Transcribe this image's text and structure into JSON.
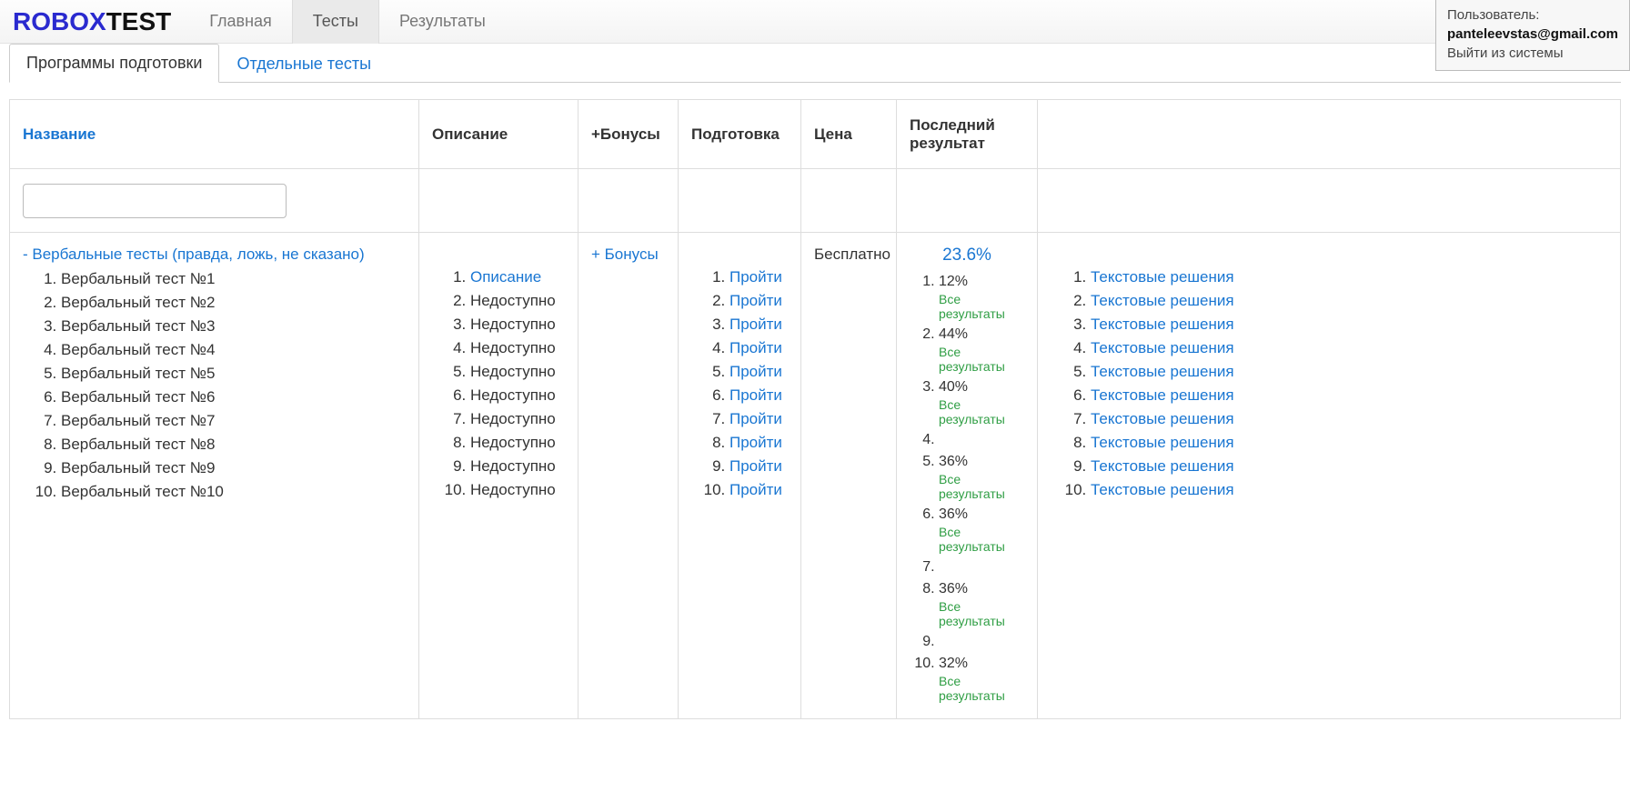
{
  "logo": {
    "part1": "ROBOX",
    "part2": "TEST"
  },
  "nav": {
    "main": "Главная",
    "tests": "Тесты",
    "results": "Результаты"
  },
  "user": {
    "label": "Пользователь:",
    "email": "panteleevstas@gmail.com",
    "logout": "Выйти из системы"
  },
  "subtabs": {
    "programs": "Программы подготовки",
    "single": "Отдельные тесты"
  },
  "headers": {
    "name": "Название",
    "desc": "Описание",
    "bonus": "+Бонусы",
    "prep": "Подготовка",
    "price": "Цена",
    "lastres": "Последний результат"
  },
  "row": {
    "collapse_prefix": "-  ",
    "title": "Вербальные тесты (правда, ложь, не сказано)",
    "tests": [
      "Вербальный тест №1",
      "Вербальный тест №2",
      "Вербальный тест №3",
      "Вербальный тест №4",
      "Вербальный тест №5",
      "Вербальный тест №6",
      "Вербальный тест №7",
      "Вербальный тест №8",
      "Вербальный тест №9",
      "Вербальный тест №10"
    ],
    "desc": [
      {
        "text": "Описание",
        "link": true
      },
      {
        "text": "Недоступно",
        "link": false
      },
      {
        "text": "Недоступно",
        "link": false
      },
      {
        "text": "Недоступно",
        "link": false
      },
      {
        "text": "Недоступно",
        "link": false
      },
      {
        "text": "Недоступно",
        "link": false
      },
      {
        "text": "Недоступно",
        "link": false
      },
      {
        "text": "Недоступно",
        "link": false
      },
      {
        "text": "Недоступно",
        "link": false
      },
      {
        "text": "Недоступно",
        "link": false
      }
    ],
    "bonus_link": "+ Бонусы",
    "prep_label": "Пройти",
    "prep_count": 10,
    "price": "Бесплатно",
    "overall_result": "23.6%",
    "results": [
      {
        "pct": "12%",
        "all": "Все результаты"
      },
      {
        "pct": "44%",
        "all": "Все результаты"
      },
      {
        "pct": "40%",
        "all": "Все результаты"
      },
      {
        "pct": "",
        "all": ""
      },
      {
        "pct": "36%",
        "all": "Все результаты"
      },
      {
        "pct": "36%",
        "all": "Все результаты"
      },
      {
        "pct": "",
        "all": ""
      },
      {
        "pct": "36%",
        "all": "Все результаты"
      },
      {
        "pct": "",
        "all": ""
      },
      {
        "pct": "32%",
        "all": "Все результаты"
      }
    ],
    "solution_label": "Текстовые решения",
    "solution_count": 10
  }
}
